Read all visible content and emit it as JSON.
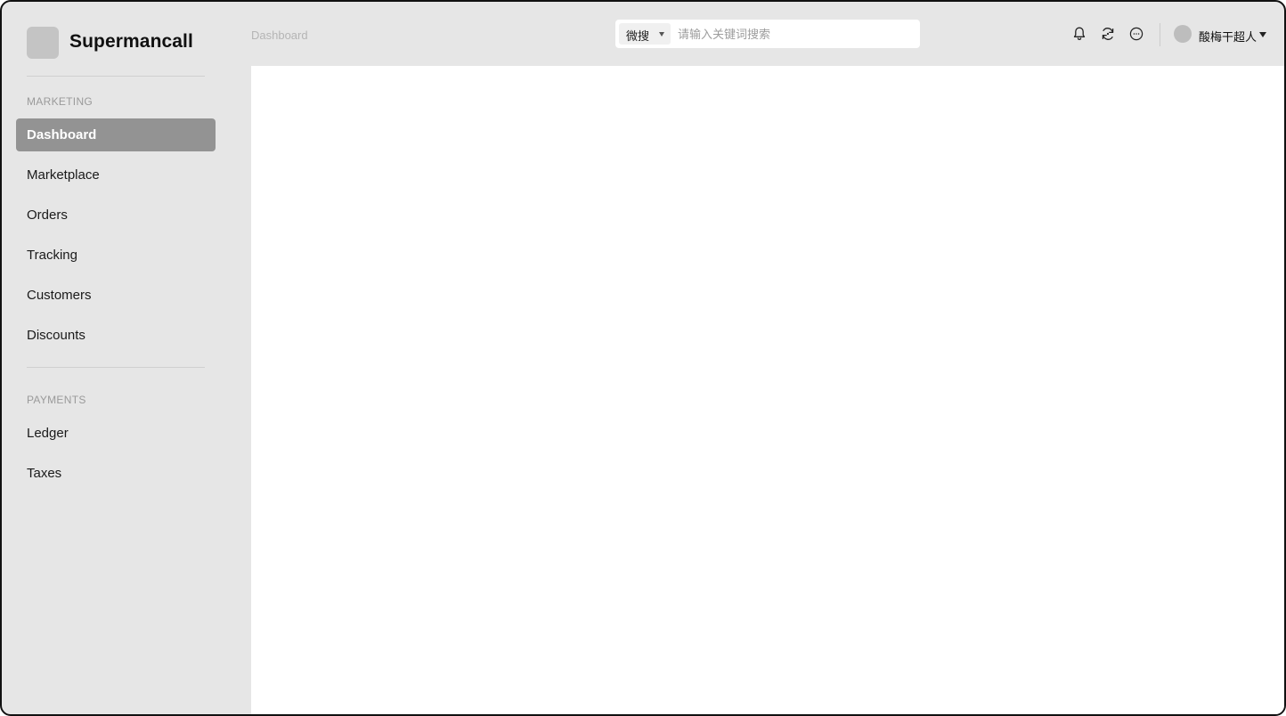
{
  "app": {
    "brand": "Supermancall"
  },
  "sidebar": {
    "sections": [
      {
        "label": "MARKETING",
        "items": [
          {
            "label": "Dashboard",
            "active": true
          },
          {
            "label": "Marketplace"
          },
          {
            "label": "Orders"
          },
          {
            "label": "Tracking"
          },
          {
            "label": "Customers"
          },
          {
            "label": "Discounts"
          }
        ]
      },
      {
        "label": "PAYMENTS",
        "items": [
          {
            "label": "Ledger"
          },
          {
            "label": "Taxes"
          }
        ]
      }
    ]
  },
  "header": {
    "breadcrumb": "Dashboard",
    "search": {
      "scope": "微搜",
      "placeholder": "请输入关键词搜索",
      "value": ""
    },
    "icons": [
      "bell-icon",
      "refresh-icon",
      "more-icon"
    ],
    "user": {
      "name": "酸梅干超人"
    }
  },
  "colors": {
    "sidebar_bg": "#e6e6e6",
    "active_item_bg": "#939393",
    "content_bg": "#ffffff"
  }
}
